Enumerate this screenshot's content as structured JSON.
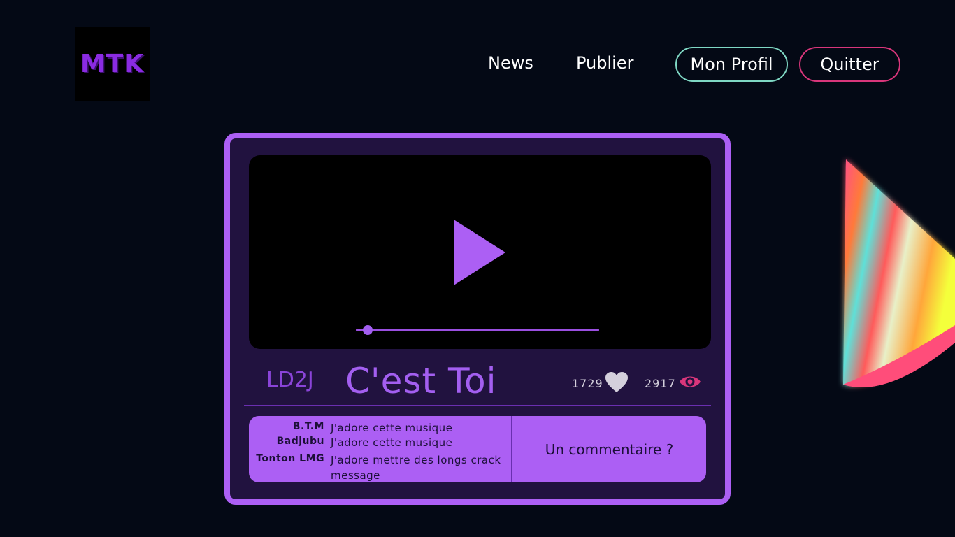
{
  "brand": {
    "logo_text": "MTK",
    "logo_color": "#8a2be2"
  },
  "nav": {
    "news_label": "News",
    "publier_label": "Publier",
    "profil_label": "Mon Profil",
    "quitter_label": "Quitter"
  },
  "colors": {
    "background": "#040915",
    "card_bg": "#21123f",
    "accent": "#ac5ff4",
    "profil_border": "#7fd8c4",
    "quitter_border": "#d9367b",
    "eye_color": "#d9367b"
  },
  "player": {
    "artist": "LD2J",
    "title": "C'est Toi",
    "likes": "1729",
    "views": "2917",
    "play_icon": "play-icon",
    "progress": 0.05
  },
  "comments": [
    {
      "author": "B.T.M",
      "text": "J'adore cette musique"
    },
    {
      "author": "Badjubu",
      "text": "J'adore cette musique"
    },
    {
      "author": "Tonton LMG",
      "text": "J'adore mettre des longs  crack message"
    }
  ],
  "comment_button_label": "Un commentaire ?"
}
